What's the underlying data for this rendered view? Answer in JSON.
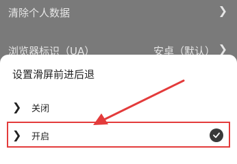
{
  "background_list": {
    "items": [
      {
        "label": "清除个人数据",
        "value": ""
      },
      {
        "label": "浏览器标识（UA）",
        "value": "安卓（默认）"
      }
    ]
  },
  "dialog": {
    "title": "设置滑屏前进后退",
    "options": [
      {
        "label": "关闭",
        "selected": false
      },
      {
        "label": "开启",
        "selected": true
      }
    ]
  },
  "annotation": {
    "color": "#e33b3b"
  }
}
